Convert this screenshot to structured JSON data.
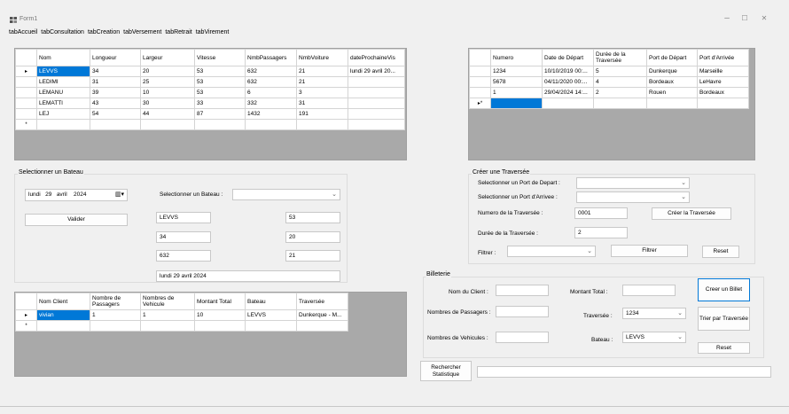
{
  "window": {
    "title": "Form1",
    "minimize": "–",
    "maximize": "☐",
    "close": "✕"
  },
  "tabs": [
    "tabAccueil",
    "tabConsultation",
    "tabCreation",
    "tabVersement",
    "tabRetrait",
    "tabVirement"
  ],
  "bateaux_grid": {
    "columns": [
      "Nom",
      "Longueur",
      "Largeur",
      "Vitesse",
      "NmbPassagers",
      "NmbVoiture",
      "dateProchaineVis"
    ],
    "rows": [
      [
        "LEVVS",
        "34",
        "20",
        "53",
        "632",
        "21",
        "lundi 29 avril 20..."
      ],
      [
        "LEDIMI",
        "31",
        "25",
        "53",
        "632",
        "21",
        ""
      ],
      [
        "LEMANU",
        "39",
        "10",
        "53",
        "6",
        "3",
        ""
      ],
      [
        "LEMATTI",
        "43",
        "30",
        "33",
        "332",
        "31",
        ""
      ],
      [
        "LEJ",
        "54",
        "44",
        "87",
        "1432",
        "191",
        ""
      ]
    ],
    "current_marker": "▸",
    "new_marker": "*"
  },
  "traversees_grid": {
    "columns": [
      "Numero",
      "Date de Départ",
      "Durée de la Traversée",
      "Port de Départ",
      "Port d'Arrivée"
    ],
    "rows": [
      [
        "1234",
        "10/10/2019 00:...",
        "5",
        "Dunkerque",
        "Marseille"
      ],
      [
        "5678",
        "04/11/2020 00:...",
        "4",
        "Bordeaux",
        "LeHavre"
      ],
      [
        "1",
        "29/04/2024 14:...",
        "2",
        "Rouen",
        "Bordeaux"
      ]
    ],
    "new_marker": "▸*"
  },
  "select_bateau": {
    "title": "Selectionner un Bateau",
    "date_day": "lundi",
    "date_num": "29",
    "date_month": "avril",
    "date_year": "2024",
    "select_label": "Selectionner un Bateau :",
    "select_value": "",
    "valider": "Valider",
    "field_nom": "LEVVS",
    "field_vitesse": "53",
    "field_longueur": "34",
    "field_largeur": "20",
    "field_passagers": "632",
    "field_voiture": "21",
    "field_date": "lundi 29 avril 2024"
  },
  "clients_grid": {
    "columns": [
      "Nom Client",
      "Nombre de Passagers",
      "Nombres de Vehicule",
      "Montant Total",
      "Bateau",
      "Traversée"
    ],
    "rows": [
      [
        "vivian",
        "1",
        "1",
        "10",
        "LEVVS",
        "Dunkerque - M..."
      ]
    ],
    "current_marker": "▸",
    "new_marker": "*"
  },
  "creer_traversee": {
    "title": "Créer une Traversée",
    "port_depart_label": "Selectionner un Port de Depart :",
    "port_arrivee_label": "Selectionner un Port d'Arrivee :",
    "numero_label": "Numero de la Traversée :",
    "numero_value": "0001",
    "creer_button": "Créer la Traversée",
    "duree_label": "Durée de la Traversée :",
    "duree_value": "2",
    "filtrer_label": "Filtrer :",
    "filtrer_button": "Filtrer",
    "reset_button": "Reset"
  },
  "billeterie": {
    "title": "Billeterie",
    "nom_client_label": "Nom du Client :",
    "montant_label": "Montant Total :",
    "creer_billet": "Creer un Billet",
    "passagers_label": "Nombres de Passagers :",
    "traversee_label": "Traversée :",
    "traversee_value": "1234",
    "trier_button": "Trier par Traversée",
    "vehicules_label": "Nombres de Vehicules :",
    "bateau_label": "Bateau :",
    "bateau_value": "LEVVS",
    "reset_button": "Reset"
  },
  "stats": {
    "button": "Rechercher Statistique",
    "value": ""
  }
}
